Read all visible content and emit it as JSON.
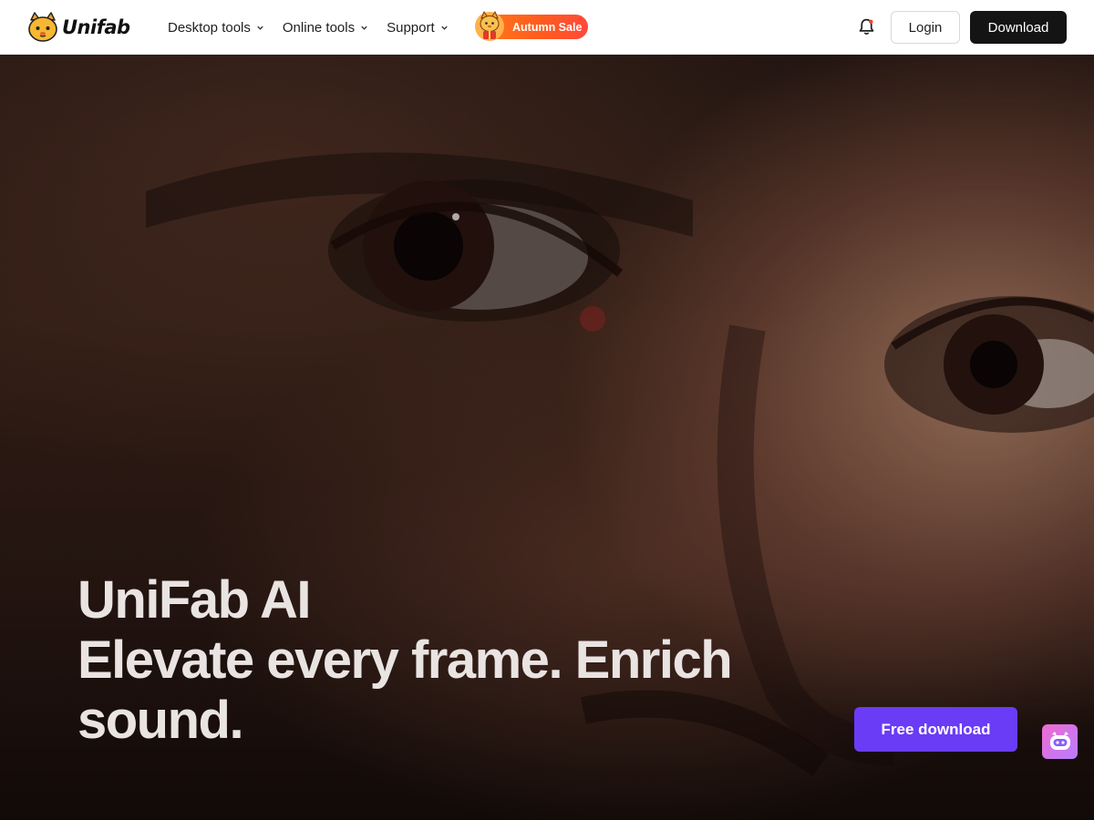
{
  "header": {
    "brand": "Unifab",
    "nav": [
      {
        "label": "Desktop tools"
      },
      {
        "label": "Online tools"
      },
      {
        "label": "Support"
      }
    ],
    "sale_label": "Autumn Sale",
    "login_label": "Login",
    "download_label": "Download"
  },
  "hero": {
    "title_line1": "UniFab AI",
    "title_line2": "Elevate every frame. Enrich",
    "title_line3": "sound.",
    "cta_label": "Free download"
  },
  "icons": {
    "logo": "cat-logo-icon",
    "chevron": "chevron-down-icon",
    "notification": "bell-icon",
    "sale": "sale-mascot-icon",
    "assistant": "chatbot-icon"
  },
  "colors": {
    "header_bg": "#ffffff",
    "download_button": "#141414",
    "cta_button": "#6a3cf5",
    "sale_gradient_start": "#ff7a1a",
    "sale_gradient_end": "#ff4a3a",
    "assistant_gradient_start": "#f06bd0",
    "assistant_gradient_end": "#b77cff"
  }
}
